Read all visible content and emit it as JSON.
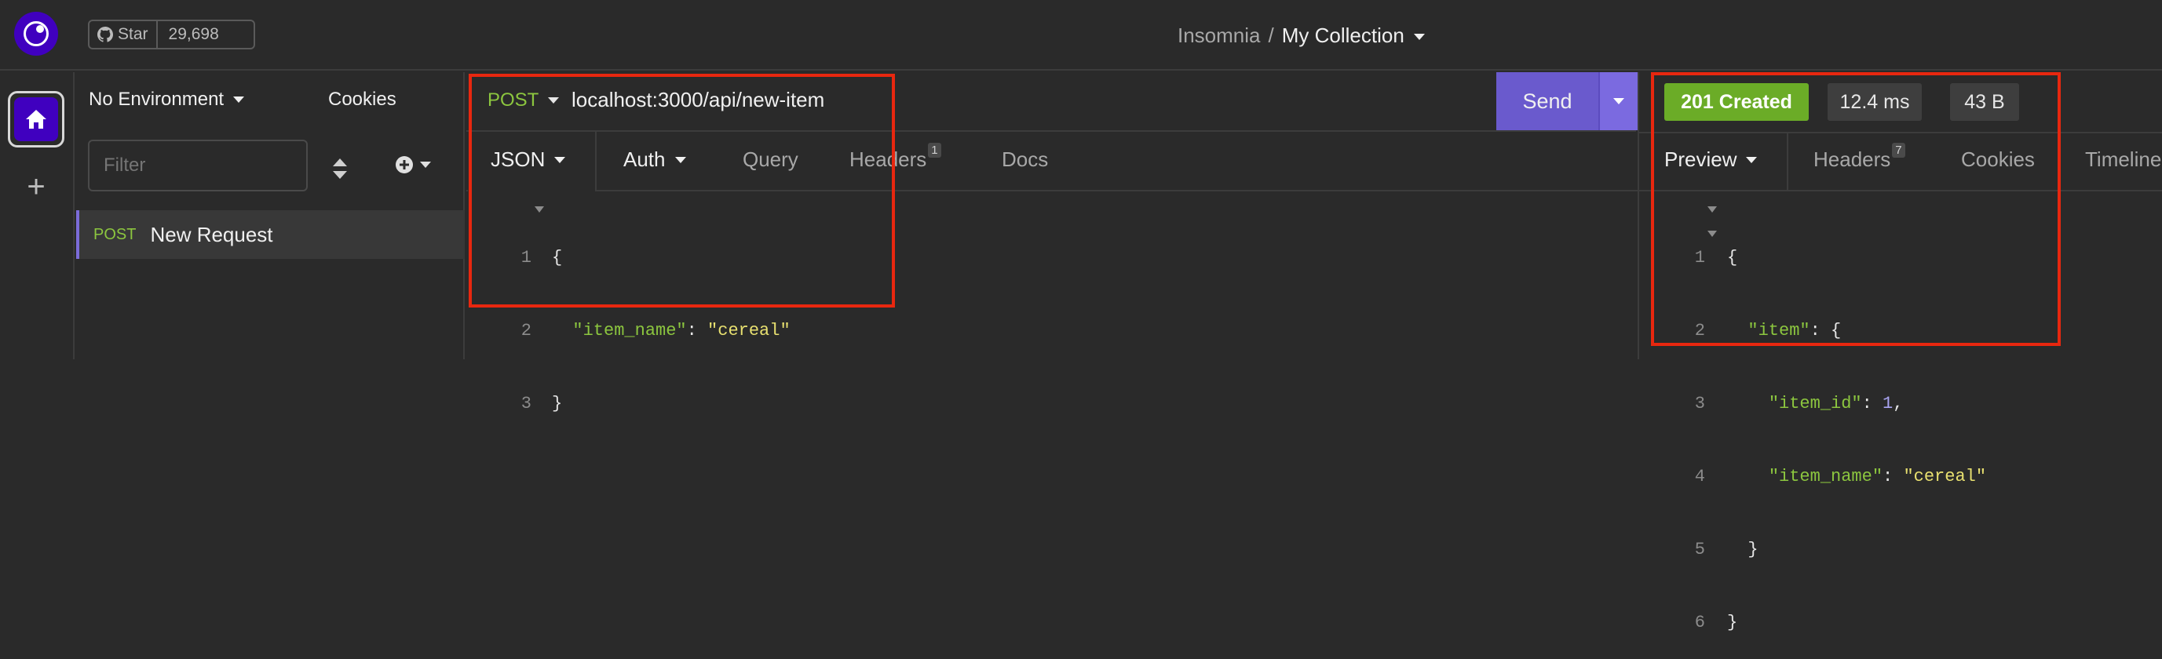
{
  "github": {
    "star_label": "Star",
    "star_count": "29,698"
  },
  "breadcrumb": {
    "app": "Insomnia",
    "separator": "/",
    "collection": "My Collection"
  },
  "sidebar": {
    "environment": "No Environment",
    "cookies": "Cookies",
    "filter_placeholder": "Filter",
    "requests": [
      {
        "method": "POST",
        "name": "New Request"
      }
    ]
  },
  "request": {
    "method": "POST",
    "url": "localhost:3000/api/new-item",
    "send_label": "Send",
    "tabs": {
      "json": "JSON",
      "auth": "Auth",
      "query": "Query",
      "headers": "Headers",
      "headers_count": "1",
      "docs": "Docs"
    },
    "body_lines": [
      "1",
      "2",
      "3"
    ],
    "body": {
      "key": "\"item_name\"",
      "value": "\"cereal\""
    }
  },
  "response": {
    "status": "201 Created",
    "time": "12.4 ms",
    "size": "43 B",
    "tabs": {
      "preview": "Preview",
      "headers": "Headers",
      "headers_count": "7",
      "cookies": "Cookies",
      "timeline": "Timeline"
    },
    "body_lines": [
      "1",
      "2",
      "3",
      "4",
      "5",
      "6"
    ],
    "body": {
      "item_key": "\"item\"",
      "id_key": "\"item_id\"",
      "id_value": "1",
      "name_key": "\"item_name\"",
      "name_value": "\"cereal\""
    }
  },
  "colors": {
    "accent": "#4000bf",
    "method_post": "#8cc63f",
    "status_ok": "#6bac27",
    "send": "#6a5acd",
    "highlight": "#e8270f"
  },
  "icons": [
    "insomnia-logo-icon",
    "github-icon",
    "home-icon",
    "plus-icon",
    "caret-down-icon",
    "sort-icon",
    "add-circle-icon"
  ]
}
